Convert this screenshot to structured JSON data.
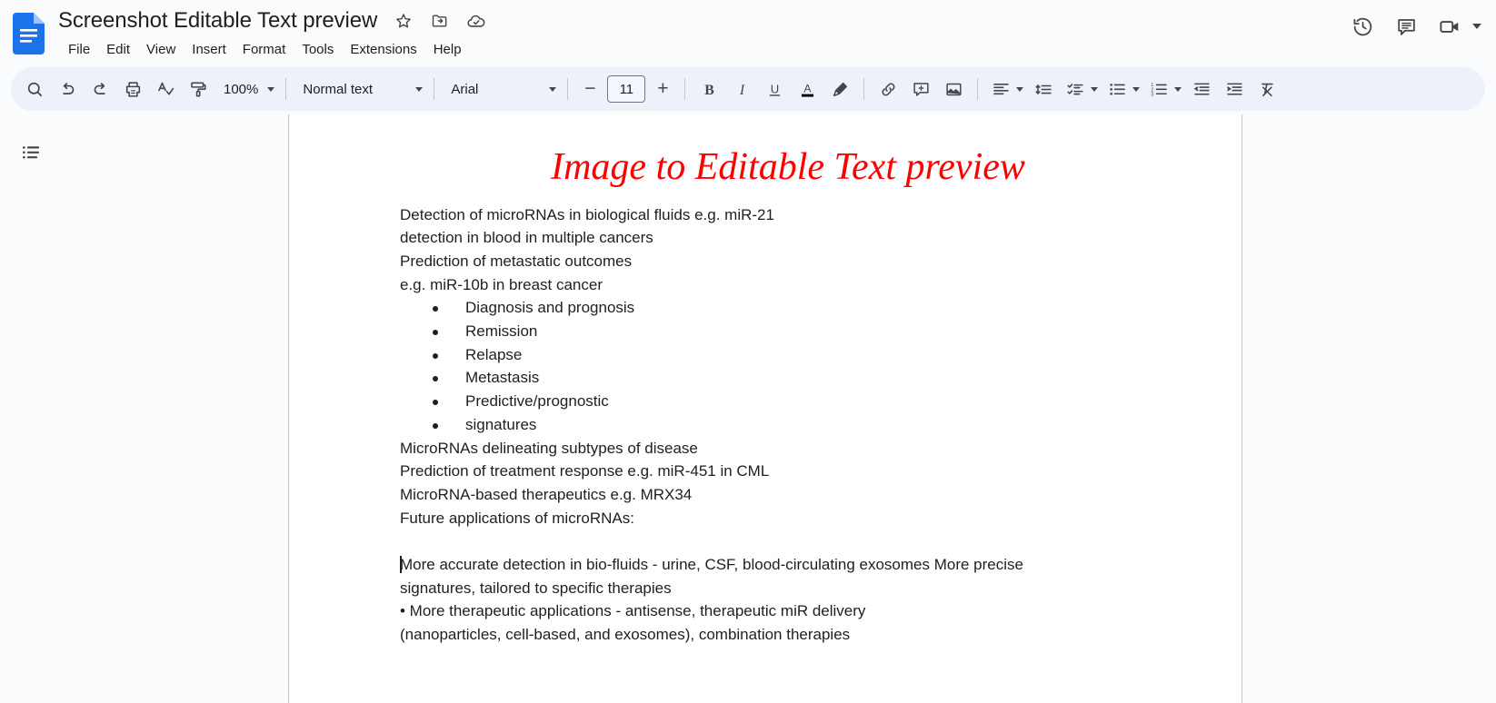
{
  "app": {
    "name": "Google Docs",
    "logo_icon": "google-docs-logo"
  },
  "header": {
    "doc_title": "Screenshot Editable Text preview",
    "title_icons": [
      {
        "name": "star-icon",
        "label": "Star"
      },
      {
        "name": "move-to-folder-icon",
        "label": "Move"
      },
      {
        "name": "cloud-saved-icon",
        "label": "Saved to Drive"
      }
    ],
    "menus": [
      {
        "label": "File"
      },
      {
        "label": "Edit"
      },
      {
        "label": "View"
      },
      {
        "label": "Insert"
      },
      {
        "label": "Format"
      },
      {
        "label": "Tools"
      },
      {
        "label": "Extensions"
      },
      {
        "label": "Help"
      }
    ],
    "right_actions": [
      {
        "name": "version-history-icon",
        "label": "Last edit"
      },
      {
        "name": "comment-history-icon",
        "label": "Open comment history"
      },
      {
        "name": "meet-camera-icon",
        "label": "Join a call"
      }
    ]
  },
  "toolbar": {
    "search_label": "Search",
    "undo_label": "Undo",
    "redo_label": "Redo",
    "print_label": "Print",
    "spelling_label": "Spelling and grammar check",
    "paint_format_label": "Paint format",
    "zoom_value": "100%",
    "style_value": "Normal text",
    "font_value": "Arial",
    "font_size_decrease": "−",
    "font_size_value": "11",
    "font_size_increase": "+",
    "bold_label": "B",
    "italic_label": "I",
    "underline_label": "U",
    "text_color_label": "A",
    "highlight_label": "Highlight color",
    "link_label": "Insert link",
    "comment_label": "Add comment",
    "image_label": "Insert image",
    "align_label": "Align",
    "line_spacing_label": "Line & paragraph spacing",
    "checklist_label": "Checklist",
    "bulleted_list_label": "Bulleted list",
    "numbered_list_label": "Numbered list",
    "decrease_indent_label": "Decrease indent",
    "increase_indent_label": "Increase indent",
    "clear_formatting_label": "Clear formatting"
  },
  "sidebar": {
    "outline_label": "Show document outline",
    "outline_icon": "document-outline-icon"
  },
  "document": {
    "heading": "Image to Editable Text preview",
    "paragraphs_before_list": [
      "Detection of microRNAs in biological fluids e.g. miR-21",
      "detection in blood in multiple cancers",
      "Prediction of metastatic outcomes",
      "e.g. miR-10b in breast cancer"
    ],
    "bullet_items": [
      "Diagnosis and prognosis",
      "Remission",
      "Relapse",
      "Metastasis",
      "Predictive/prognostic",
      "signatures"
    ],
    "paragraphs_after_list": [
      "MicroRNAs delineating subtypes of disease",
      "Prediction of treatment response e.g. miR-451 in CML",
      "MicroRNA-based therapeutics e.g. MRX34",
      "Future applications of microRNAs:"
    ],
    "final_block": [
      "More accurate detection in bio-fluids - urine, CSF, blood-circulating exosomes More precise",
      "signatures, tailored to specific therapies",
      "• More therapeutic applications - antisense, therapeutic miR delivery",
      "(nanoparticles, cell-based, and exosomes), combination therapies"
    ]
  },
  "colors": {
    "heading_red": "#ff0000",
    "toolbar_bg": "#edf2fa",
    "app_bg": "#f9fbfd",
    "page_bg": "#ffffff",
    "logo_blue": "#1a73e8"
  }
}
